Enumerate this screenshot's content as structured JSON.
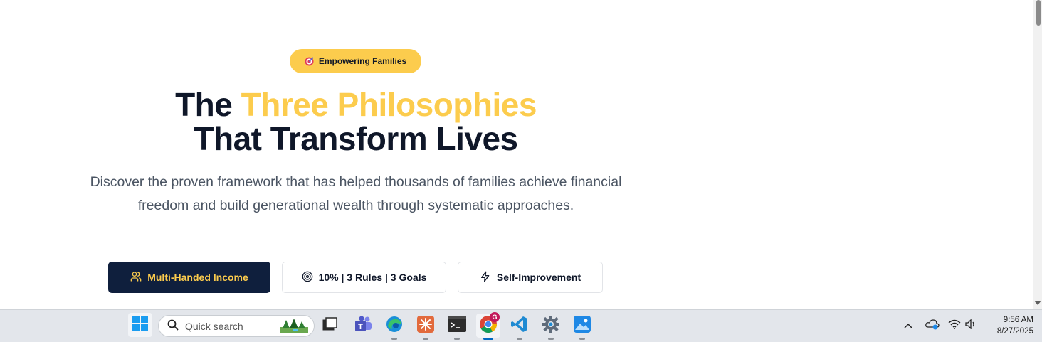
{
  "hero": {
    "badge": {
      "icon": "dart-target-icon",
      "label": "Empowering Families"
    },
    "title_part1": "The",
    "title_highlight": "Three Philosophies",
    "title_line2": "That Transform Lives",
    "subtitle_line1": "Discover the proven framework that has helped thousands of families achieve financial",
    "subtitle_line2": "freedom and build generational wealth through systematic approaches.",
    "accent_color": "#fccc4d",
    "dark_color": "#0f1f3d"
  },
  "tabs": [
    {
      "label": "Multi-Handed Income",
      "icon": "users-icon",
      "active": true
    },
    {
      "label": "10% | 3 Rules | 3 Goals",
      "icon": "target-icon",
      "active": false
    },
    {
      "label": "Self-Improvement",
      "icon": "lightning-icon",
      "active": false
    }
  ],
  "taskbar": {
    "search_placeholder": "Quick search",
    "apps": [
      "start-icon",
      "task-view-icon",
      "teams-icon",
      "edge-icon",
      "claude-icon",
      "terminal-icon",
      "chrome-icon",
      "vscode-icon",
      "settings-icon",
      "photos-icon"
    ],
    "chrome_badge": "G",
    "time": "9:56 AM",
    "date": "8/27/2025"
  }
}
